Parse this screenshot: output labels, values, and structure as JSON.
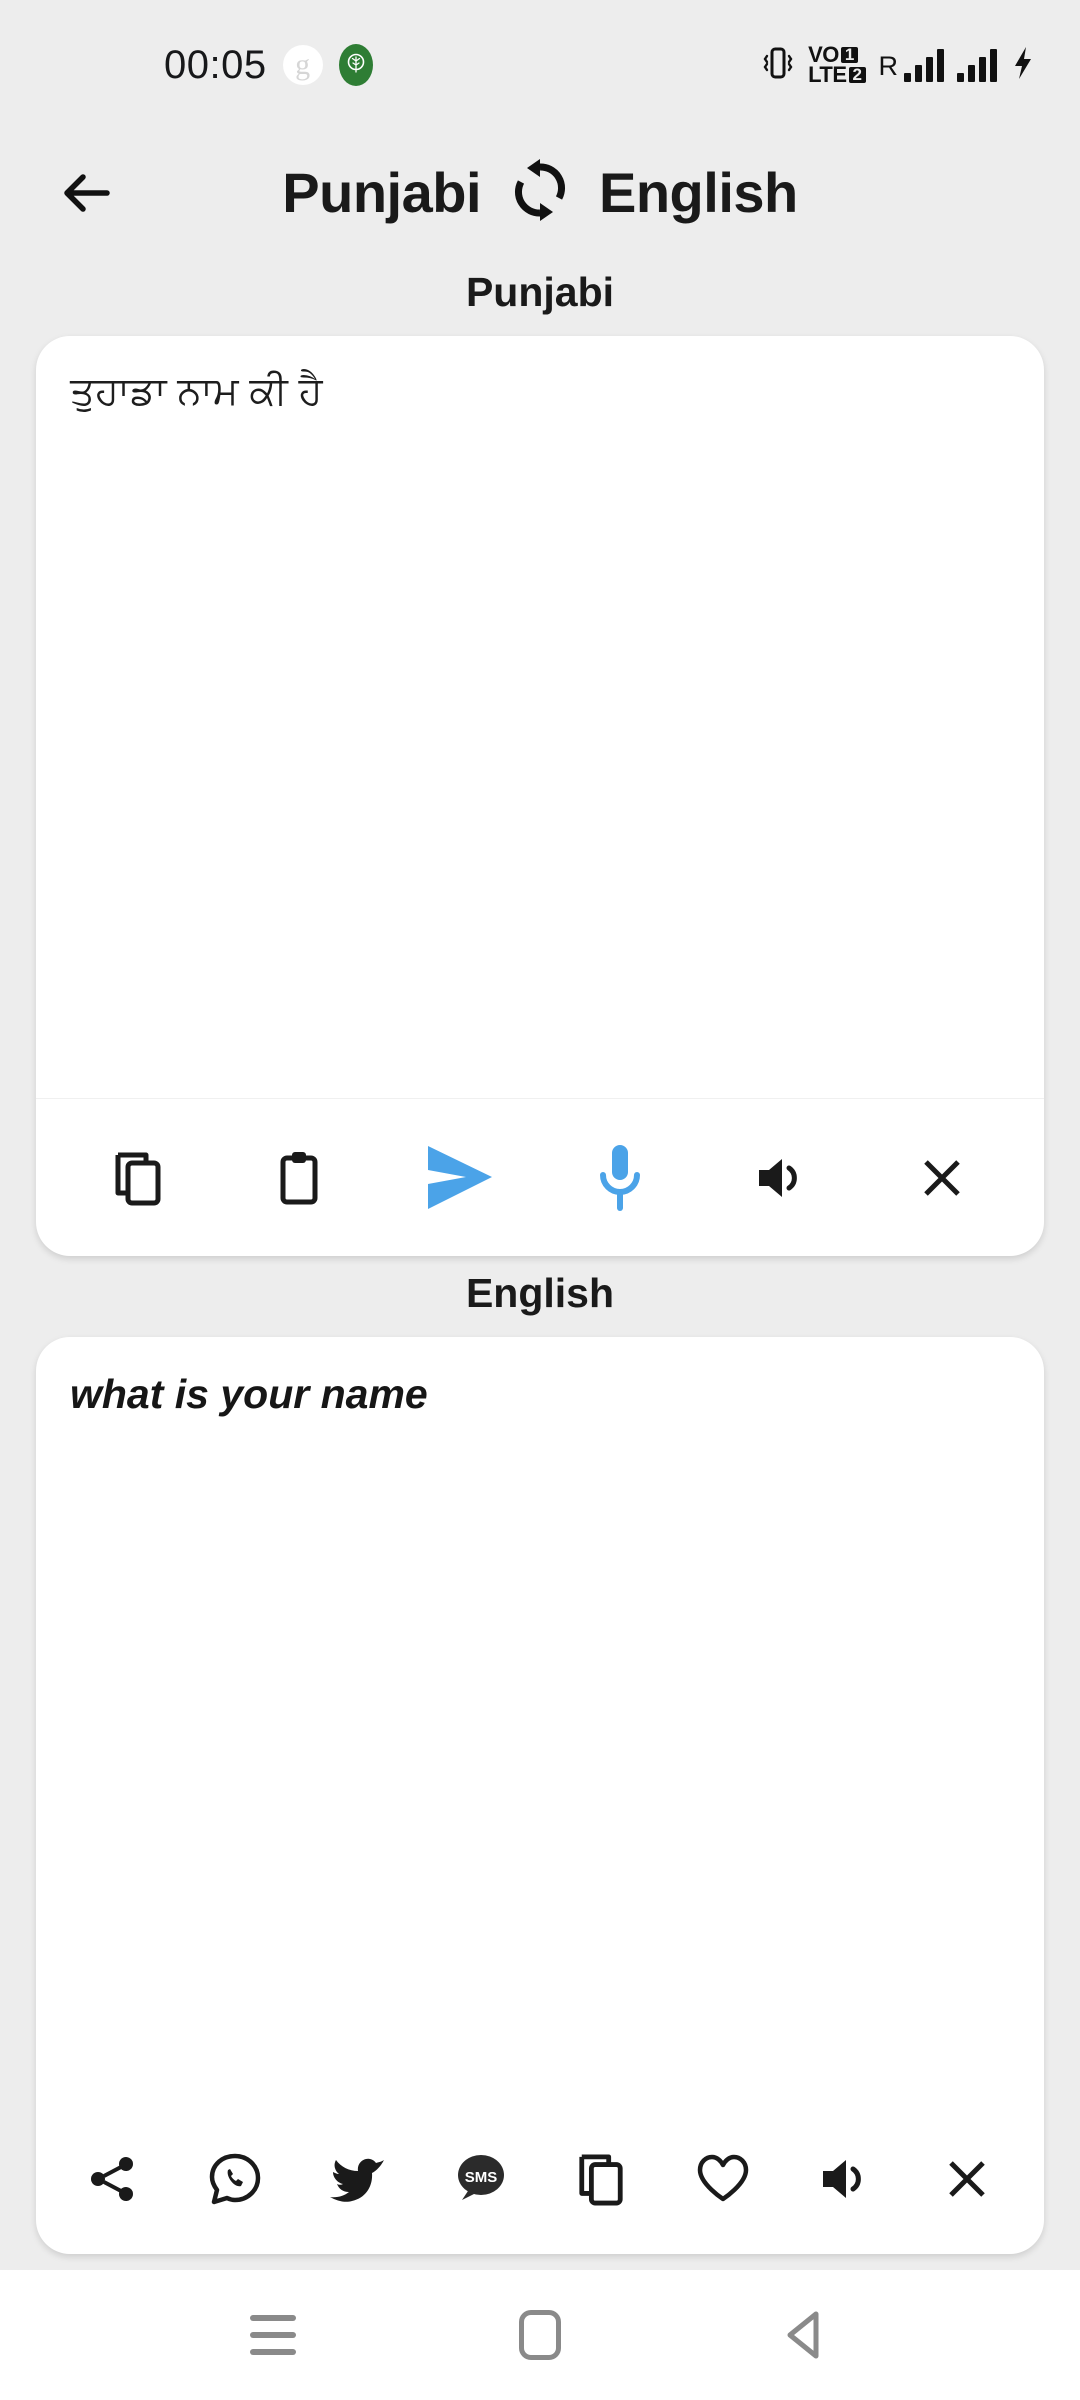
{
  "status_bar": {
    "clock": "00:05",
    "notification_icons": [
      "google-g-icon",
      "tree-app-icon"
    ],
    "right_icons": [
      "vibrate-icon",
      "volte-icon",
      "roaming-signal-icon",
      "signal-icon",
      "charging-bolt-icon"
    ],
    "volte_line1": "VO",
    "volte_line2": "LTE",
    "volte_badge1": "1",
    "volte_badge2": "2",
    "roaming_letter": "R"
  },
  "header": {
    "back_icon": "arrow-left-icon",
    "source_language": "Punjabi",
    "swap_icon": "swap-languages-icon",
    "target_language": "English"
  },
  "source_panel": {
    "label": "Punjabi",
    "text": "ਤੁਹਾਡਾ ਨਾਮ ਕੀ ਹੈ",
    "toolbar": [
      {
        "name": "copy-button",
        "icon": "copy-icon",
        "color": "#1a1a1a"
      },
      {
        "name": "paste-button",
        "icon": "clipboard-icon",
        "color": "#1a1a1a"
      },
      {
        "name": "translate-button",
        "icon": "send-icon",
        "color": "#4ba3e8"
      },
      {
        "name": "voice-input-button",
        "icon": "microphone-icon",
        "color": "#4ba3e8"
      },
      {
        "name": "speak-button",
        "icon": "speaker-icon",
        "color": "#1a1a1a"
      },
      {
        "name": "clear-button",
        "icon": "close-icon",
        "color": "#1a1a1a"
      }
    ]
  },
  "target_panel": {
    "label": "English",
    "text": "what is your name",
    "toolbar": [
      {
        "name": "share-button",
        "icon": "share-icon",
        "color": "#1a1a1a"
      },
      {
        "name": "whatsapp-button",
        "icon": "whatsapp-icon",
        "color": "#1a1a1a"
      },
      {
        "name": "twitter-button",
        "icon": "twitter-icon",
        "color": "#1a1a1a"
      },
      {
        "name": "sms-button",
        "icon": "sms-icon",
        "color": "#1a1a1a",
        "label": "SMS"
      },
      {
        "name": "copy-button",
        "icon": "copy-icon",
        "color": "#1a1a1a"
      },
      {
        "name": "favorite-button",
        "icon": "heart-icon",
        "color": "#1a1a1a"
      },
      {
        "name": "speak-button",
        "icon": "speaker-icon",
        "color": "#1a1a1a"
      },
      {
        "name": "clear-button",
        "icon": "close-icon",
        "color": "#1a1a1a"
      }
    ]
  },
  "nav_bar": {
    "recents_icon": "menu-lines-icon",
    "home_icon": "home-square-icon",
    "back_icon": "back-triangle-icon"
  },
  "colors": {
    "background": "#ededed",
    "card": "#ffffff",
    "accent": "#4ba3e8",
    "text": "#1a1a1a",
    "nav_icon": "#8a8a8a"
  }
}
